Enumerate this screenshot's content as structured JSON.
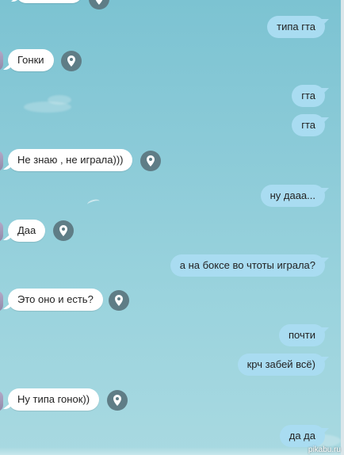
{
  "messages": [
    {
      "text": "типа гта"
    },
    {
      "text": "Гонки"
    },
    {
      "text": "гта"
    },
    {
      "text": "гта"
    },
    {
      "text": "Не знаю , не играла)))"
    },
    {
      "text": "ну дааа..."
    },
    {
      "text": "Даа"
    },
    {
      "text": "а на боксе во чтоты играла?"
    },
    {
      "text": "Это оно и есть?"
    },
    {
      "text": "почти"
    },
    {
      "text": "крч забей всё)"
    },
    {
      "text": "Ну типа гонок))"
    },
    {
      "text": "да да"
    }
  ],
  "watermark": "pikabu.ru",
  "colors": {
    "incoming_bubble": "#ffffff",
    "outgoing_bubble": "#a9dcf1",
    "location_icon_bg": "#5f7d86",
    "background": "#8ccbd8"
  },
  "icons": {
    "location": "map-pin-icon"
  }
}
